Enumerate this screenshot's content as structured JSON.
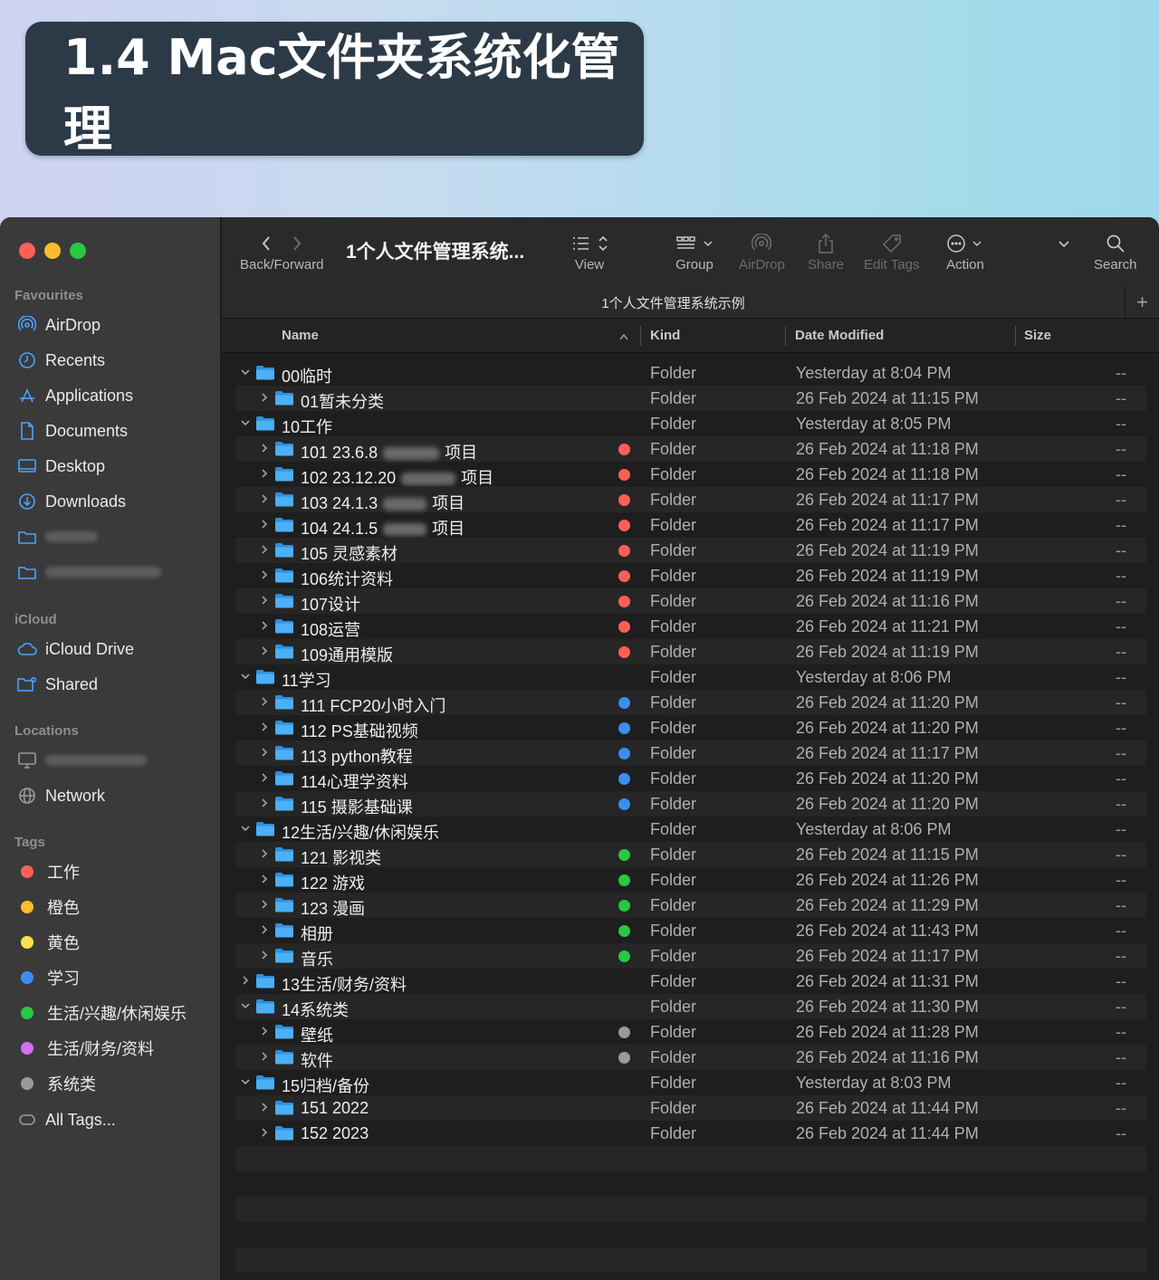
{
  "banner": {
    "title": "1.4 Mac文件夹系统化管理"
  },
  "sidebar": {
    "favourites_label": "Favourites",
    "favourites": [
      {
        "label": "AirDrop",
        "icon": "airdrop-icon"
      },
      {
        "label": "Recents",
        "icon": "clock-icon"
      },
      {
        "label": "Applications",
        "icon": "applications-icon"
      },
      {
        "label": "Documents",
        "icon": "document-icon"
      },
      {
        "label": "Desktop",
        "icon": "desktop-icon"
      },
      {
        "label": "Downloads",
        "icon": "download-icon"
      }
    ],
    "icloud_label": "iCloud",
    "icloud": [
      {
        "label": "iCloud Drive",
        "icon": "cloud-icon"
      },
      {
        "label": "Shared",
        "icon": "shared-folder-icon"
      }
    ],
    "locations_label": "Locations",
    "locations": [
      {
        "label": "Network",
        "icon": "network-icon"
      }
    ],
    "tags_label": "Tags",
    "tags": [
      {
        "label": "工作",
        "color": "#ff5f57"
      },
      {
        "label": "橙色",
        "color": "#febc2e"
      },
      {
        "label": "黄色",
        "color": "#ffe14d"
      },
      {
        "label": "学习",
        "color": "#3b8ef0"
      },
      {
        "label": "生活/兴趣/休闲娱乐",
        "color": "#28c840"
      },
      {
        "label": "生活/财务/资料",
        "color": "#d36ef5"
      },
      {
        "label": "系统类",
        "color": "#9a9a9c"
      }
    ],
    "all_tags": "All Tags..."
  },
  "toolbar": {
    "back_forward": "Back/Forward",
    "title": "1个人文件管理系统...",
    "view": "View",
    "group": "Group",
    "airdrop": "AirDrop",
    "share": "Share",
    "edit_tags": "Edit Tags",
    "action": "Action",
    "search": "Search"
  },
  "pathbar": {
    "title": "1个人文件管理系统示例"
  },
  "columns": {
    "name": "Name",
    "kind": "Kind",
    "date": "Date Modified",
    "size": "Size"
  },
  "rows": [
    {
      "level": 0,
      "expanded": true,
      "name": "00临时",
      "kind": "Folder",
      "date": "Yesterday at 8:04 PM",
      "size": "--"
    },
    {
      "level": 1,
      "expanded": false,
      "name": "01暂未分类",
      "kind": "Folder",
      "date": "26 Feb 2024 at 11:15 PM",
      "size": "--"
    },
    {
      "level": 0,
      "expanded": true,
      "name": "10工作",
      "kind": "Folder",
      "date": "Yesterday at 8:05 PM",
      "size": "--"
    },
    {
      "level": 1,
      "expanded": false,
      "name": "101 23.6.8",
      "blur": 62,
      "suffix": "项目",
      "tag": "#ff5f57",
      "kind": "Folder",
      "date": "26 Feb 2024 at 11:18 PM",
      "size": "--"
    },
    {
      "level": 1,
      "expanded": false,
      "name": "102 23.12.20",
      "blur": 60,
      "suffix": "项目",
      "tag": "#ff5f57",
      "kind": "Folder",
      "date": "26 Feb 2024 at 11:18 PM",
      "size": "--"
    },
    {
      "level": 1,
      "expanded": false,
      "name": "103 24.1.3",
      "blur": 48,
      "suffix": "项目",
      "tag": "#ff5f57",
      "kind": "Folder",
      "date": "26 Feb 2024 at 11:17 PM",
      "size": "--"
    },
    {
      "level": 1,
      "expanded": false,
      "name": "104 24.1.5",
      "blur": 48,
      "suffix": "项目",
      "tag": "#ff5f57",
      "kind": "Folder",
      "date": "26 Feb 2024 at 11:17 PM",
      "size": "--"
    },
    {
      "level": 1,
      "expanded": false,
      "name": "105 灵感素材",
      "tag": "#ff5f57",
      "kind": "Folder",
      "date": "26 Feb 2024 at 11:19 PM",
      "size": "--"
    },
    {
      "level": 1,
      "expanded": false,
      "name": "106统计资料",
      "tag": "#ff5f57",
      "kind": "Folder",
      "date": "26 Feb 2024 at 11:19 PM",
      "size": "--"
    },
    {
      "level": 1,
      "expanded": false,
      "name": "107设计",
      "tag": "#ff5f57",
      "kind": "Folder",
      "date": "26 Feb 2024 at 11:16 PM",
      "size": "--"
    },
    {
      "level": 1,
      "expanded": false,
      "name": "108运营",
      "tag": "#ff5f57",
      "kind": "Folder",
      "date": "26 Feb 2024 at 11:21 PM",
      "size": "--"
    },
    {
      "level": 1,
      "expanded": false,
      "name": "109通用模版",
      "tag": "#ff5f57",
      "kind": "Folder",
      "date": "26 Feb 2024 at 11:19 PM",
      "size": "--"
    },
    {
      "level": 0,
      "expanded": true,
      "name": "11学习",
      "kind": "Folder",
      "date": "Yesterday at 8:06 PM",
      "size": "--"
    },
    {
      "level": 1,
      "expanded": false,
      "name": "111 FCP20小时入门",
      "tag": "#3b8ef0",
      "kind": "Folder",
      "date": "26 Feb 2024 at 11:20 PM",
      "size": "--"
    },
    {
      "level": 1,
      "expanded": false,
      "name": "112 PS基础视频",
      "tag": "#3b8ef0",
      "kind": "Folder",
      "date": "26 Feb 2024 at 11:20 PM",
      "size": "--"
    },
    {
      "level": 1,
      "expanded": false,
      "name": "113 python教程",
      "tag": "#3b8ef0",
      "kind": "Folder",
      "date": "26 Feb 2024 at 11:17 PM",
      "size": "--"
    },
    {
      "level": 1,
      "expanded": false,
      "name": "114心理学资料",
      "tag": "#3b8ef0",
      "kind": "Folder",
      "date": "26 Feb 2024 at 11:20 PM",
      "size": "--"
    },
    {
      "level": 1,
      "expanded": false,
      "name": "115 摄影基础课",
      "tag": "#3b8ef0",
      "kind": "Folder",
      "date": "26 Feb 2024 at 11:20 PM",
      "size": "--"
    },
    {
      "level": 0,
      "expanded": true,
      "name": "12生活/兴趣/休闲娱乐",
      "kind": "Folder",
      "date": "Yesterday at 8:06 PM",
      "size": "--"
    },
    {
      "level": 1,
      "expanded": false,
      "name": "121 影视类",
      "tag": "#28c840",
      "kind": "Folder",
      "date": "26 Feb 2024 at 11:15 PM",
      "size": "--"
    },
    {
      "level": 1,
      "expanded": false,
      "name": "122 游戏",
      "tag": "#28c840",
      "kind": "Folder",
      "date": "26 Feb 2024 at 11:26 PM",
      "size": "--"
    },
    {
      "level": 1,
      "expanded": false,
      "name": "123 漫画",
      "tag": "#28c840",
      "kind": "Folder",
      "date": "26 Feb 2024 at 11:29 PM",
      "size": "--"
    },
    {
      "level": 1,
      "expanded": false,
      "name": "相册",
      "tag": "#28c840",
      "kind": "Folder",
      "date": "26 Feb 2024 at 11:43 PM",
      "size": "--"
    },
    {
      "level": 1,
      "expanded": false,
      "name": "音乐",
      "tag": "#28c840",
      "kind": "Folder",
      "date": "26 Feb 2024 at 11:17 PM",
      "size": "--"
    },
    {
      "level": 0,
      "expanded": false,
      "name": "13生活/财务/资料",
      "kind": "Folder",
      "date": "26 Feb 2024 at 11:31 PM",
      "size": "--"
    },
    {
      "level": 0,
      "expanded": true,
      "name": "14系统类",
      "kind": "Folder",
      "date": "26 Feb 2024 at 11:30 PM",
      "size": "--"
    },
    {
      "level": 1,
      "expanded": false,
      "name": "壁纸",
      "tag": "#9a9a9c",
      "kind": "Folder",
      "date": "26 Feb 2024 at 11:28 PM",
      "size": "--"
    },
    {
      "level": 1,
      "expanded": false,
      "name": "软件",
      "tag": "#9a9a9c",
      "kind": "Folder",
      "date": "26 Feb 2024 at 11:16 PM",
      "size": "--"
    },
    {
      "level": 0,
      "expanded": true,
      "name": "15归档/备份",
      "kind": "Folder",
      "date": "Yesterday at 8:03 PM",
      "size": "--"
    },
    {
      "level": 1,
      "expanded": false,
      "name": "151 2022",
      "kind": "Folder",
      "date": "26 Feb 2024 at 11:44 PM",
      "size": "--"
    },
    {
      "level": 1,
      "expanded": false,
      "name": "152 2023",
      "kind": "Folder",
      "date": "26 Feb 2024 at 11:44 PM",
      "size": "--"
    }
  ]
}
